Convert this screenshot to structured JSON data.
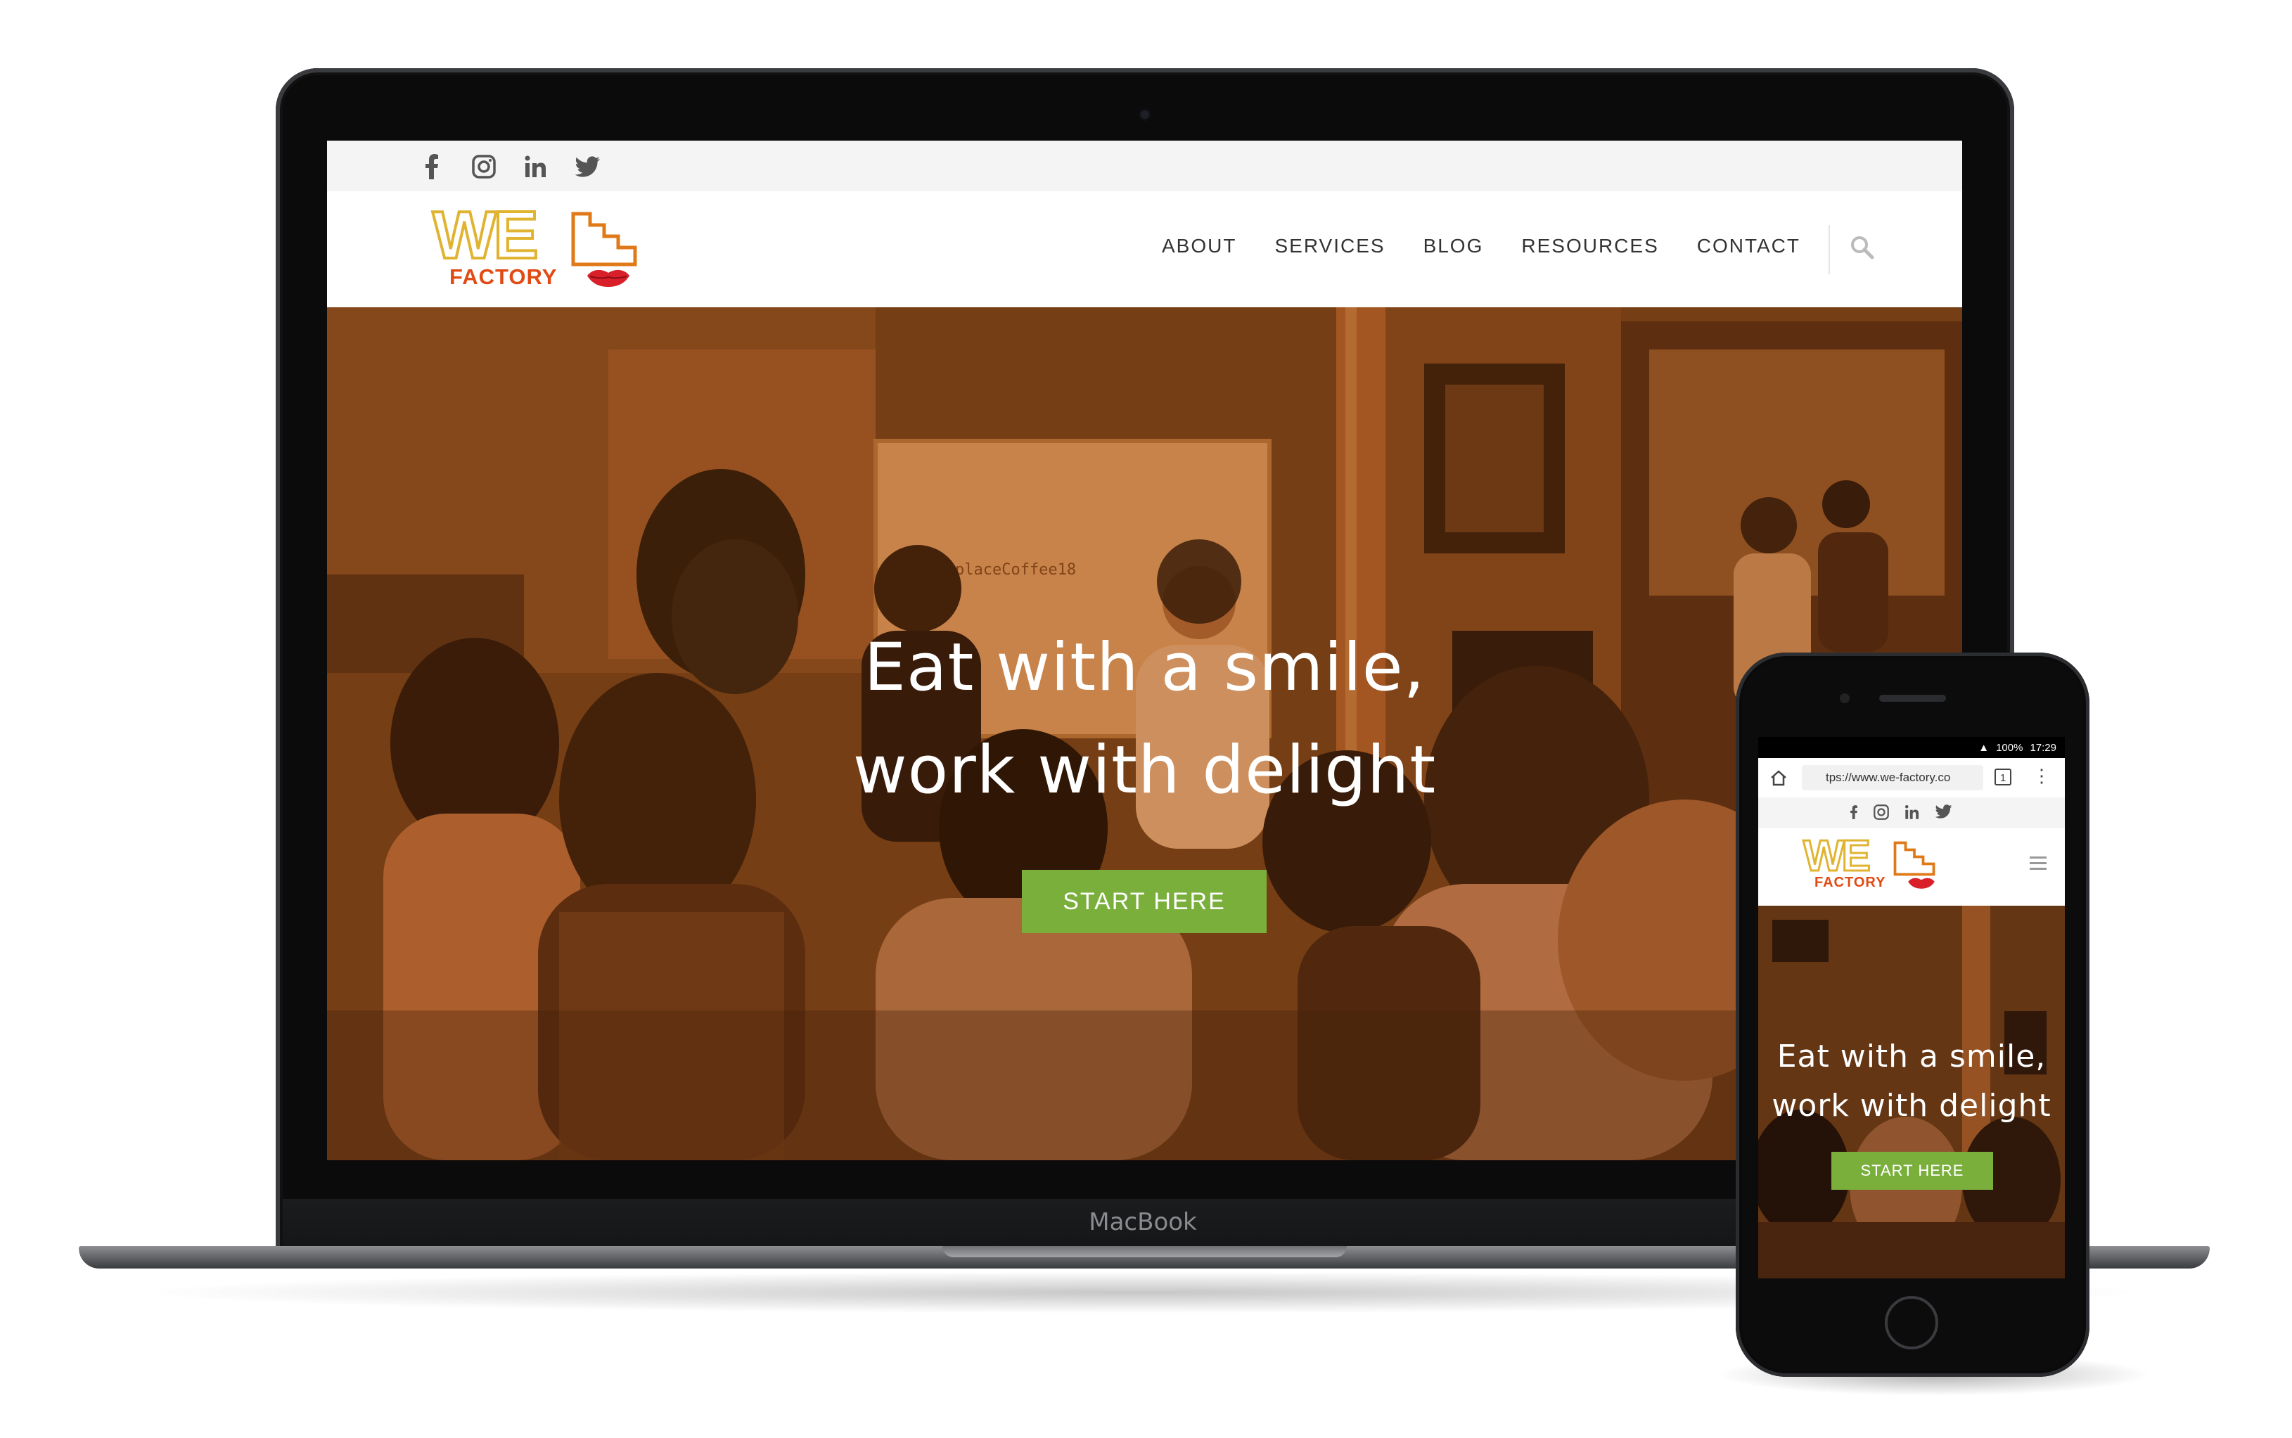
{
  "social": [
    "facebook-icon",
    "instagram-icon",
    "linkedin-icon",
    "twitter-icon"
  ],
  "logo": {
    "mark": "WE",
    "name": "FACTORY"
  },
  "nav": [
    "ABOUT",
    "SERVICES",
    "BLOG",
    "RESOURCES",
    "CONTACT"
  ],
  "hero": {
    "line1": "Eat with a smile,",
    "line2": "work with delight",
    "cta": "START HERE",
    "board_text": "WorkplaceCoffee18"
  },
  "laptop_brand": "MacBook",
  "phone": {
    "battery": "100%",
    "time": "17:29",
    "url": "tps://www.we-factory.co",
    "tab_count": "1"
  },
  "colors": {
    "accent_green": "#7aaf3c",
    "logo_yellow": "#e0b430",
    "logo_orange": "#e24a14",
    "lips_red": "#d81f2a"
  }
}
